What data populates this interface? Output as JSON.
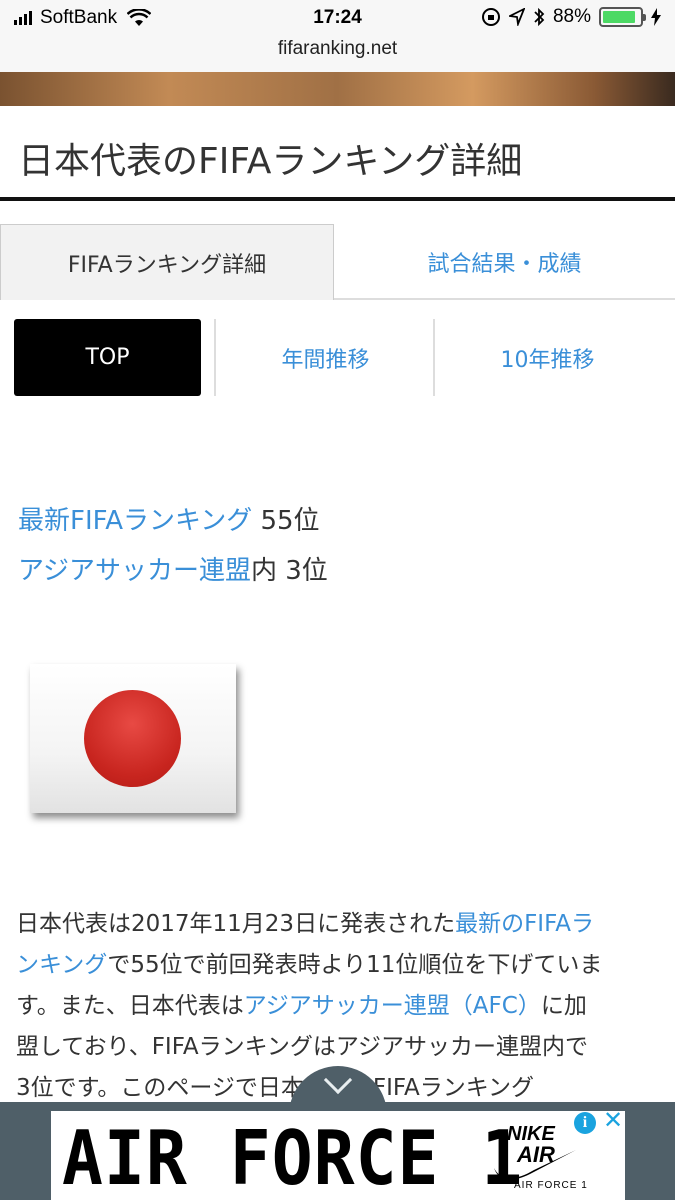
{
  "status_bar": {
    "carrier": "SoftBank",
    "time": "17:24",
    "battery": "88%",
    "battery_level": 0.88
  },
  "url_bar": {
    "domain": "fifaranking.net"
  },
  "page": {
    "title": "日本代表のFIFAランキング詳細"
  },
  "tabs": [
    {
      "label": "FIFAランキング詳細",
      "active": true
    },
    {
      "label": "試合結果・成績",
      "active": false
    }
  ],
  "subtabs": [
    {
      "label": "TOP",
      "active": true
    },
    {
      "label": "年間推移",
      "active": false
    },
    {
      "label": "10年推移",
      "active": false
    }
  ],
  "rankings": {
    "fifa_link": "最新FIFAランキング",
    "fifa_rank": "55位",
    "afc_link": "アジアサッカー連盟",
    "afc_suffix": "内",
    "afc_rank": "3位"
  },
  "description": {
    "l1a": "日本代表は2017年11月23日に発表された",
    "l1b": "最新のFIFAラ",
    "l2a": "ンキング",
    "l2b": "で55位で前回発表時より11位順位を下げていま",
    "l3a": "す。また、日本代表は",
    "l3b": "アジアサッカー連盟（AFC）",
    "l3c": "に加",
    "l4": "盟しており、FIFAランキングはアジアサッカー連盟内で",
    "l5": "3位です。このページで日本代表のFIFAランキング"
  },
  "ad": {
    "headline": "AIR FORCE 1",
    "brand": "NIKE",
    "brand_sub": "AIR",
    "tagline": "AIR FORCE 1",
    "info_icon": "info-icon",
    "close_icon": "close-icon",
    "collapse_icon": "chevron-down-icon"
  },
  "colors": {
    "link": "#3a8fd8",
    "active_subtab": "#000000",
    "battery": "#4cd964",
    "ad_bar": "#4f5f68",
    "flag_red": "#c8251f"
  }
}
